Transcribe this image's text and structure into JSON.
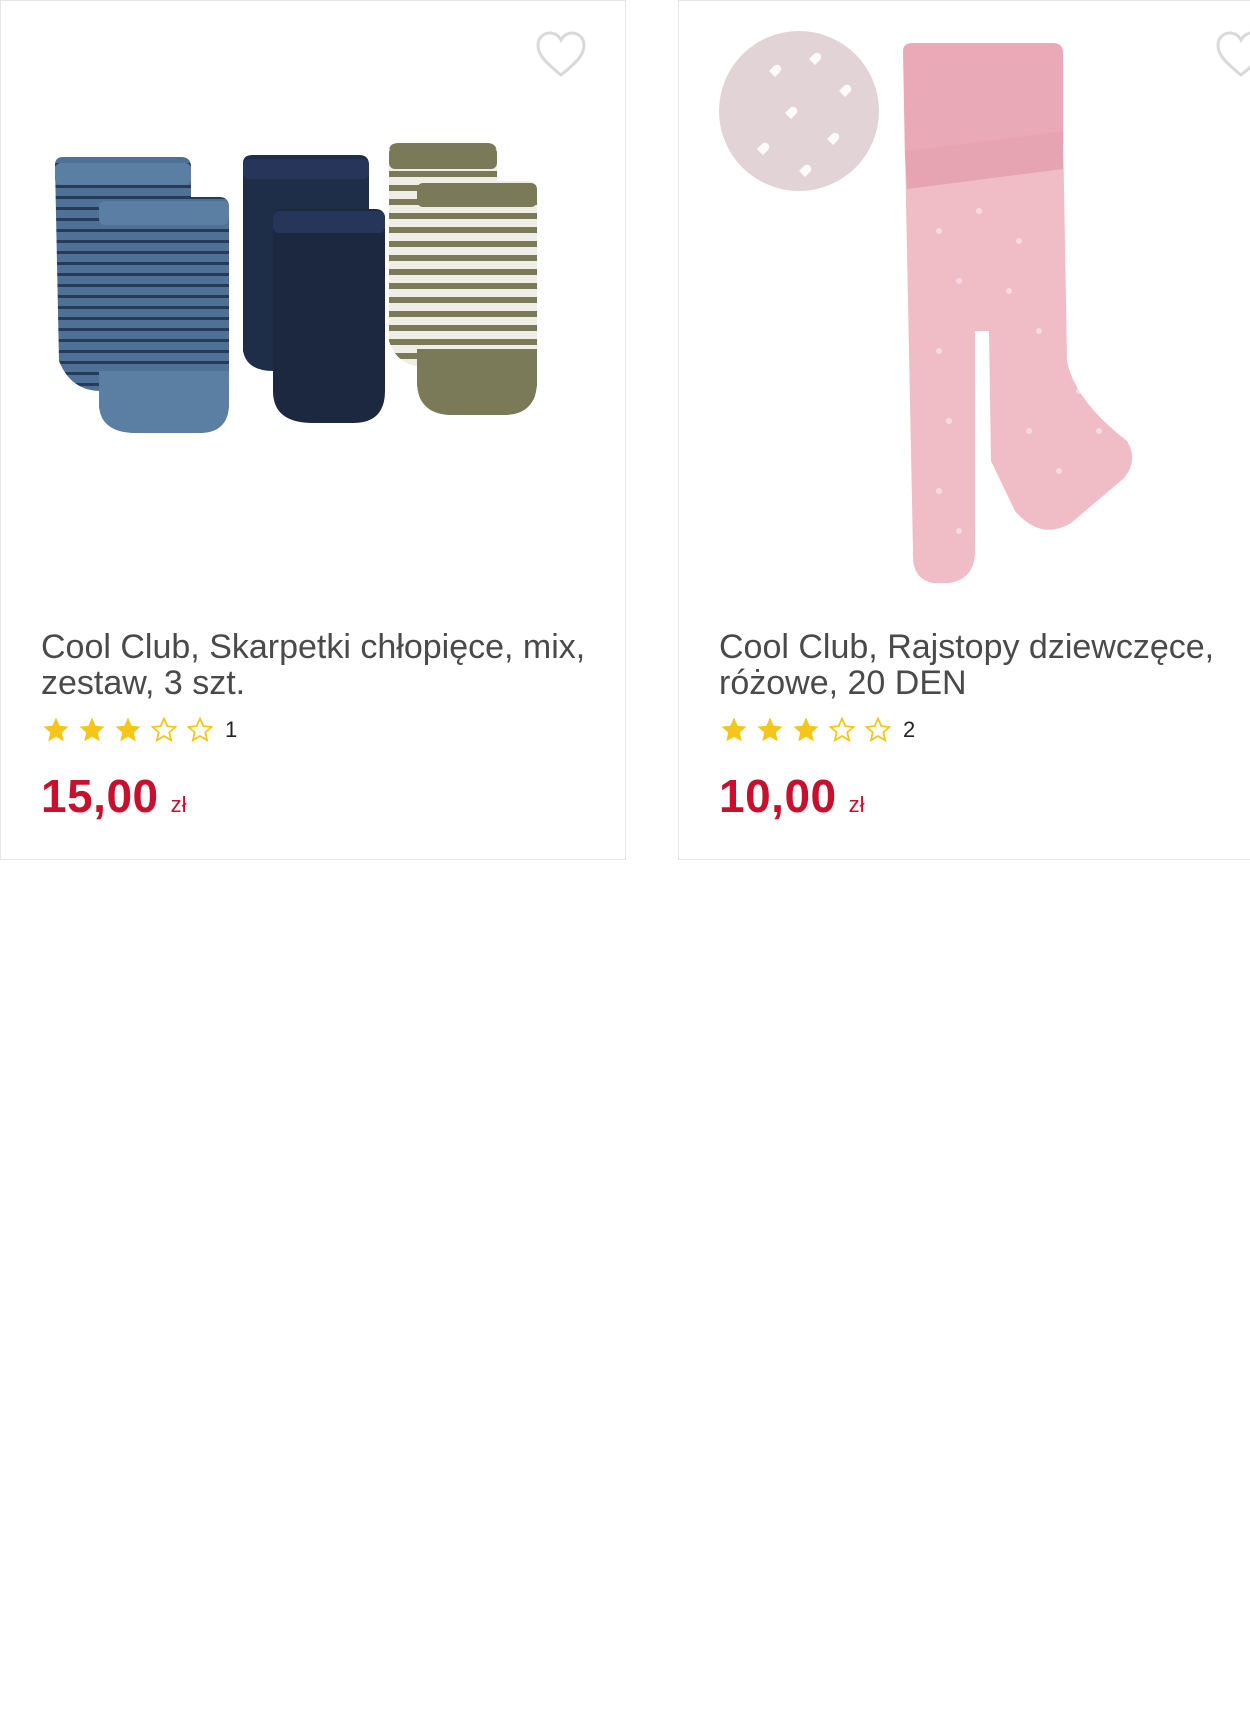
{
  "colors": {
    "price": "#c8102e",
    "star_filled": "#f5c518",
    "star_empty": "#f5c518",
    "favorite_outline": "#d9d9d9",
    "card_border": "#e6e6e6"
  },
  "products": [
    {
      "title": "Cool Club, Skarpetki chłopięce, mix, zestaw, 3 szt.",
      "rating_value": 3,
      "rating_max": 5,
      "rating_count": "1",
      "price": "15,00",
      "currency": "zł",
      "image_icon": "socks-set-image",
      "favorite_icon": "heart-outline-icon"
    },
    {
      "title": "Cool Club, Rajstopy dziewczęce, różowe, 20 DEN",
      "rating_value": 3,
      "rating_max": 5,
      "rating_count": "2",
      "price": "10,00",
      "currency": "zł",
      "image_icon": "pink-tights-image",
      "favorite_icon": "heart-outline-icon"
    }
  ]
}
